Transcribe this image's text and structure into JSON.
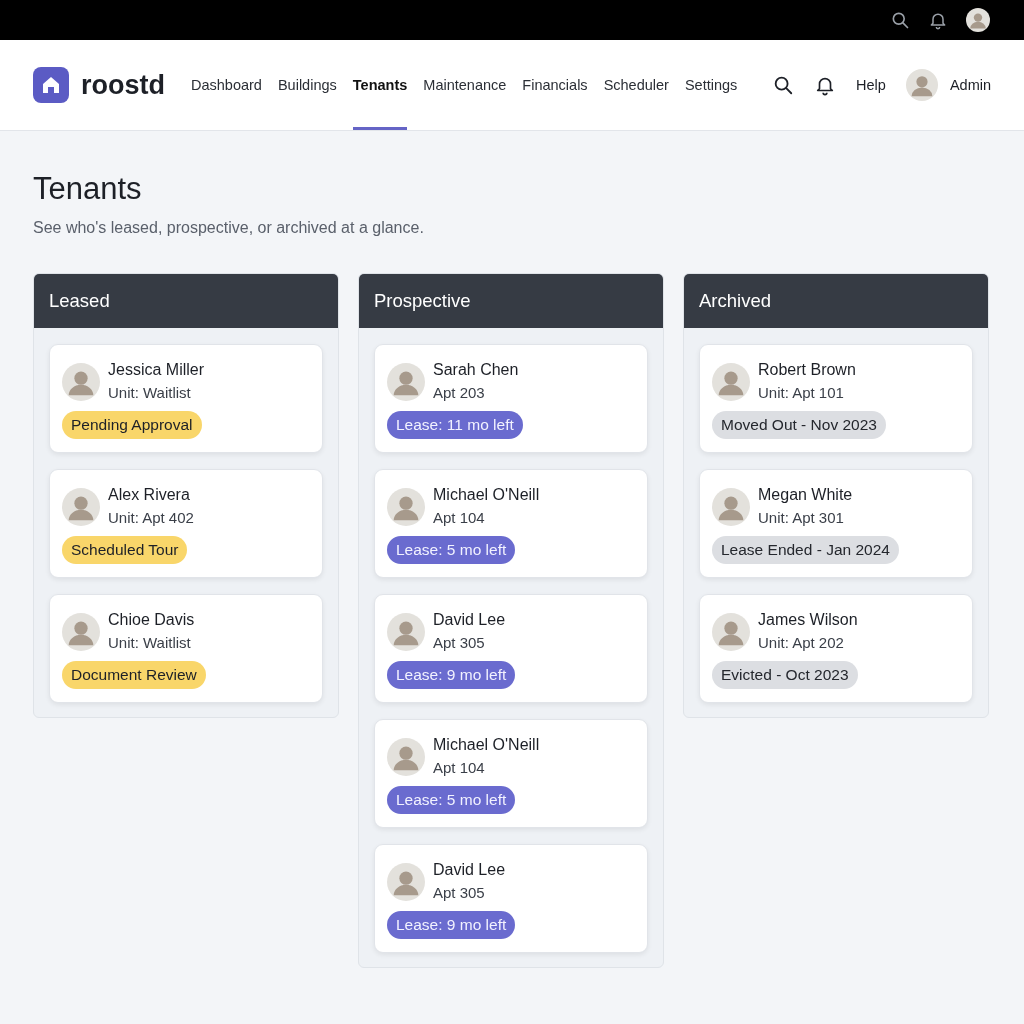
{
  "brand": "roostd",
  "nav": [
    {
      "label": "Dashboard",
      "selected": false
    },
    {
      "label": "Buildings",
      "selected": false
    },
    {
      "label": "Tenants",
      "selected": true
    },
    {
      "label": "Maintenance",
      "selected": false
    },
    {
      "label": "Financials",
      "selected": false
    },
    {
      "label": "Scheduler",
      "selected": false
    },
    {
      "label": "Settings",
      "selected": false
    }
  ],
  "help": "Help",
  "user": "Admin",
  "page": {
    "title": "Tenants",
    "subtitle": "See who's leased, prospective, or archived at a glance."
  },
  "columns": [
    {
      "title": "Leased",
      "cards": [
        {
          "name": "Jessica Miller",
          "unit": "Unit: Waitlist",
          "tag": "Pending Approval",
          "kind": "pending"
        },
        {
          "name": "Alex Rivera",
          "unit": "Unit: Apt 402",
          "tag": "Scheduled Tour",
          "kind": "pending"
        },
        {
          "name": "Chioe Davis",
          "unit": "Unit: Waitlist",
          "tag": "Document Review",
          "kind": "pending"
        }
      ]
    },
    {
      "title": "Prospective",
      "cards": [
        {
          "name": "Sarah Chen",
          "unit": "Apt 203",
          "tag": "Lease: 11 mo left",
          "kind": "lease"
        },
        {
          "name": "Michael O'Neill",
          "unit": "Apt 104",
          "tag": "Lease: 5 mo left",
          "kind": "lease"
        },
        {
          "name": "David Lee",
          "unit": "Apt 305",
          "tag": "Lease: 9 mo left",
          "kind": "lease"
        },
        {
          "name": "Michael O'Neill",
          "unit": "Apt 104",
          "tag": "Lease: 5 mo left",
          "kind": "lease"
        },
        {
          "name": "David Lee",
          "unit": "Apt 305",
          "tag": "Lease: 9 mo left",
          "kind": "lease"
        }
      ]
    },
    {
      "title": "Archived",
      "cards": [
        {
          "name": "Robert Brown",
          "unit": "Unit: Apt 101",
          "tag": "Moved Out - Nov 2023",
          "kind": "archived"
        },
        {
          "name": "Megan White",
          "unit": "Unit: Apt 301",
          "tag": "Lease Ended - Jan 2024",
          "kind": "archived"
        },
        {
          "name": "James Wilson",
          "unit": "Unit: Apt 202",
          "tag": "Evicted - Oct 2023",
          "kind": "archived"
        }
      ]
    }
  ]
}
